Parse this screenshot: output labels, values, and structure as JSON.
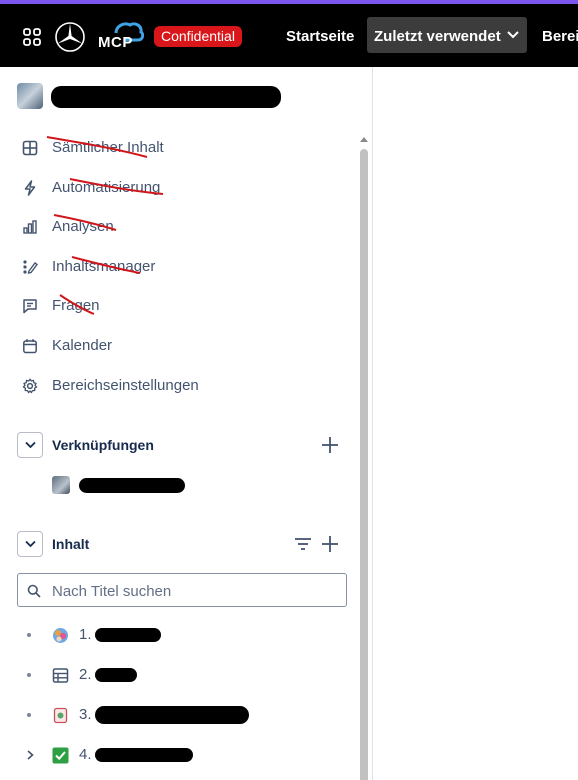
{
  "topbar": {
    "badge": "Confidential",
    "logo_text": "MCP",
    "nav": {
      "home": "Startseite",
      "recent": "Zuletzt verwendet",
      "spaces_partial": "Berei"
    }
  },
  "sidebar": {
    "menu": [
      {
        "label": "Sämtlicher Inhalt",
        "icon": "grid-icon"
      },
      {
        "label": "Automatisierung",
        "icon": "lightning-icon"
      },
      {
        "label": "Analysen",
        "icon": "bar-chart-icon"
      },
      {
        "label": "Inhaltsmanager",
        "icon": "pencil-icon"
      },
      {
        "label": "Fragen",
        "icon": "speech-bubble-icon"
      },
      {
        "label": "Kalender",
        "icon": "calendar-icon"
      },
      {
        "label": "Bereichseinstellungen",
        "icon": "gear-icon"
      }
    ],
    "shortcuts": {
      "title": "Verknüpfungen"
    },
    "content": {
      "title": "Inhalt",
      "search_placeholder": "Nach Titel suchen",
      "items": [
        {
          "num": "1.",
          "icon": "colorful-avatar-icon"
        },
        {
          "num": "2.",
          "icon": "table-icon"
        },
        {
          "num": "3.",
          "icon": "document-icon"
        },
        {
          "num": "4.",
          "icon": "checkbox-icon"
        }
      ]
    }
  },
  "colors": {
    "accent_stripe": "#7b57f0",
    "badge_red": "#d9161a",
    "topbar_bg": "#000000",
    "text_muted": "#44546f"
  }
}
